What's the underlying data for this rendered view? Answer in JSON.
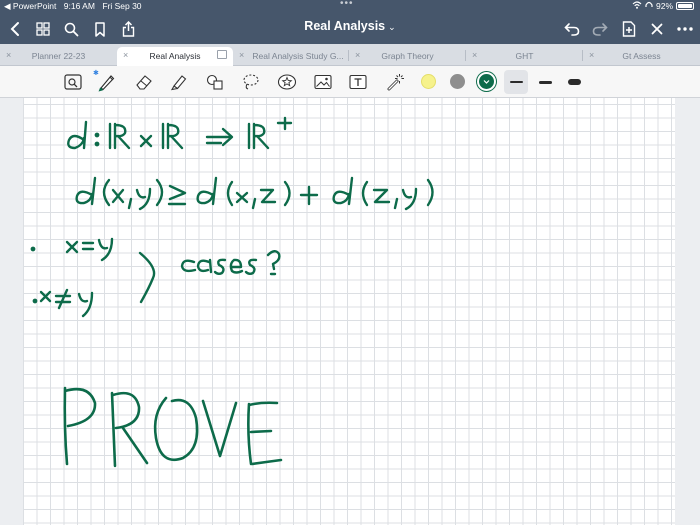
{
  "status_bar": {
    "back_app": "◀ PowerPoint",
    "time": "9:16 AM",
    "date": "Fri Sep 30",
    "battery": "92%"
  },
  "header": {
    "title": "Real Analysis",
    "title_chevron": "⌄"
  },
  "tabs": [
    {
      "label": "Planner 22-23",
      "active": false
    },
    {
      "label": "Real Analysis",
      "active": true
    },
    {
      "label": "Real Analysis Study G...",
      "active": false
    },
    {
      "label": "Graph Theory",
      "active": false
    },
    {
      "label": "GHT",
      "active": false
    },
    {
      "label": "Gt Assess",
      "active": false
    }
  ],
  "toolbar": {
    "tools": [
      "zoom-box",
      "pen",
      "eraser",
      "highlighter",
      "shapes",
      "lasso",
      "sticker",
      "image",
      "text",
      "laser-pointer"
    ],
    "colors": {
      "yellow": "#f6f28c",
      "gray": "#8e8e8e",
      "green": "#0d6b4a"
    },
    "stroke_widths": [
      "thin",
      "medium",
      "thick"
    ]
  },
  "colors": {
    "header_bg": "#46566b",
    "ink": "#0d6b4a"
  }
}
